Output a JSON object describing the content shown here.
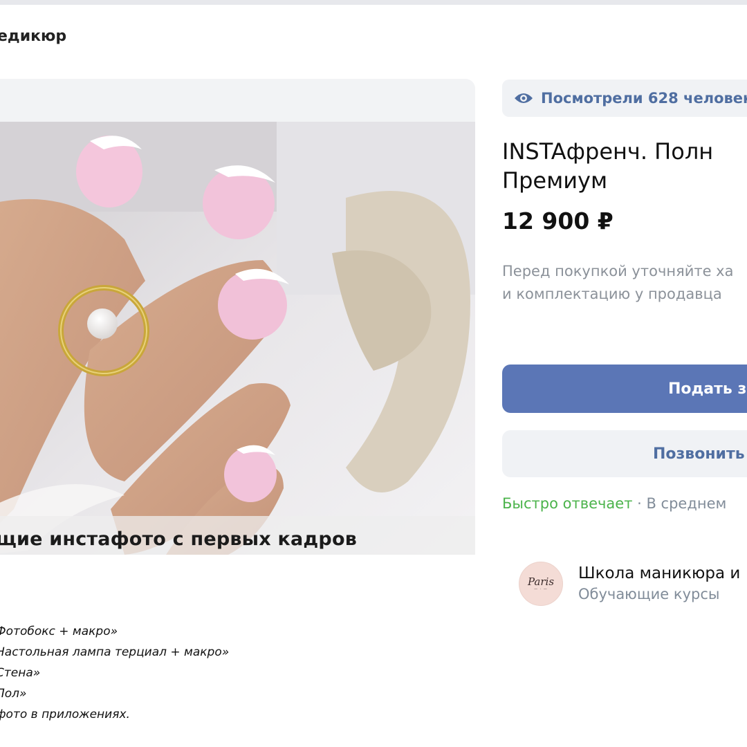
{
  "breadcrumb_title": "едикюр",
  "card": {
    "photo_caption": "щие инстафото с первых кадров",
    "description_lines": [
      "Фотобокс + макро»",
      "Настольная лампа терциал + макро»",
      "Стена»",
      "Пол»",
      "фото в приложениях."
    ]
  },
  "views": {
    "icon": "eye-icon",
    "text": "Посмотрели 628 человек"
  },
  "product": {
    "title_line1": "INSTAфренч. Полн",
    "title_line2": "Премиум",
    "price": "12 900 ₽"
  },
  "note": {
    "line1": "Перед покупкой уточняйте ха",
    "line2": "и комплектацию у продавца"
  },
  "buttons": {
    "primary_label": "Подать з",
    "secondary_label": "Позвонить"
  },
  "reply": {
    "fast": "Быстро отвечает",
    "separator": " · ",
    "rest": "В среднем"
  },
  "seller": {
    "logo_text": "Paris",
    "name": "Школа маникюра и",
    "category": "Обучающие курсы"
  },
  "colors": {
    "accent": "#5b76b6",
    "link": "#4f6ea1",
    "green": "#4bb34b",
    "muted": "#818c99"
  }
}
